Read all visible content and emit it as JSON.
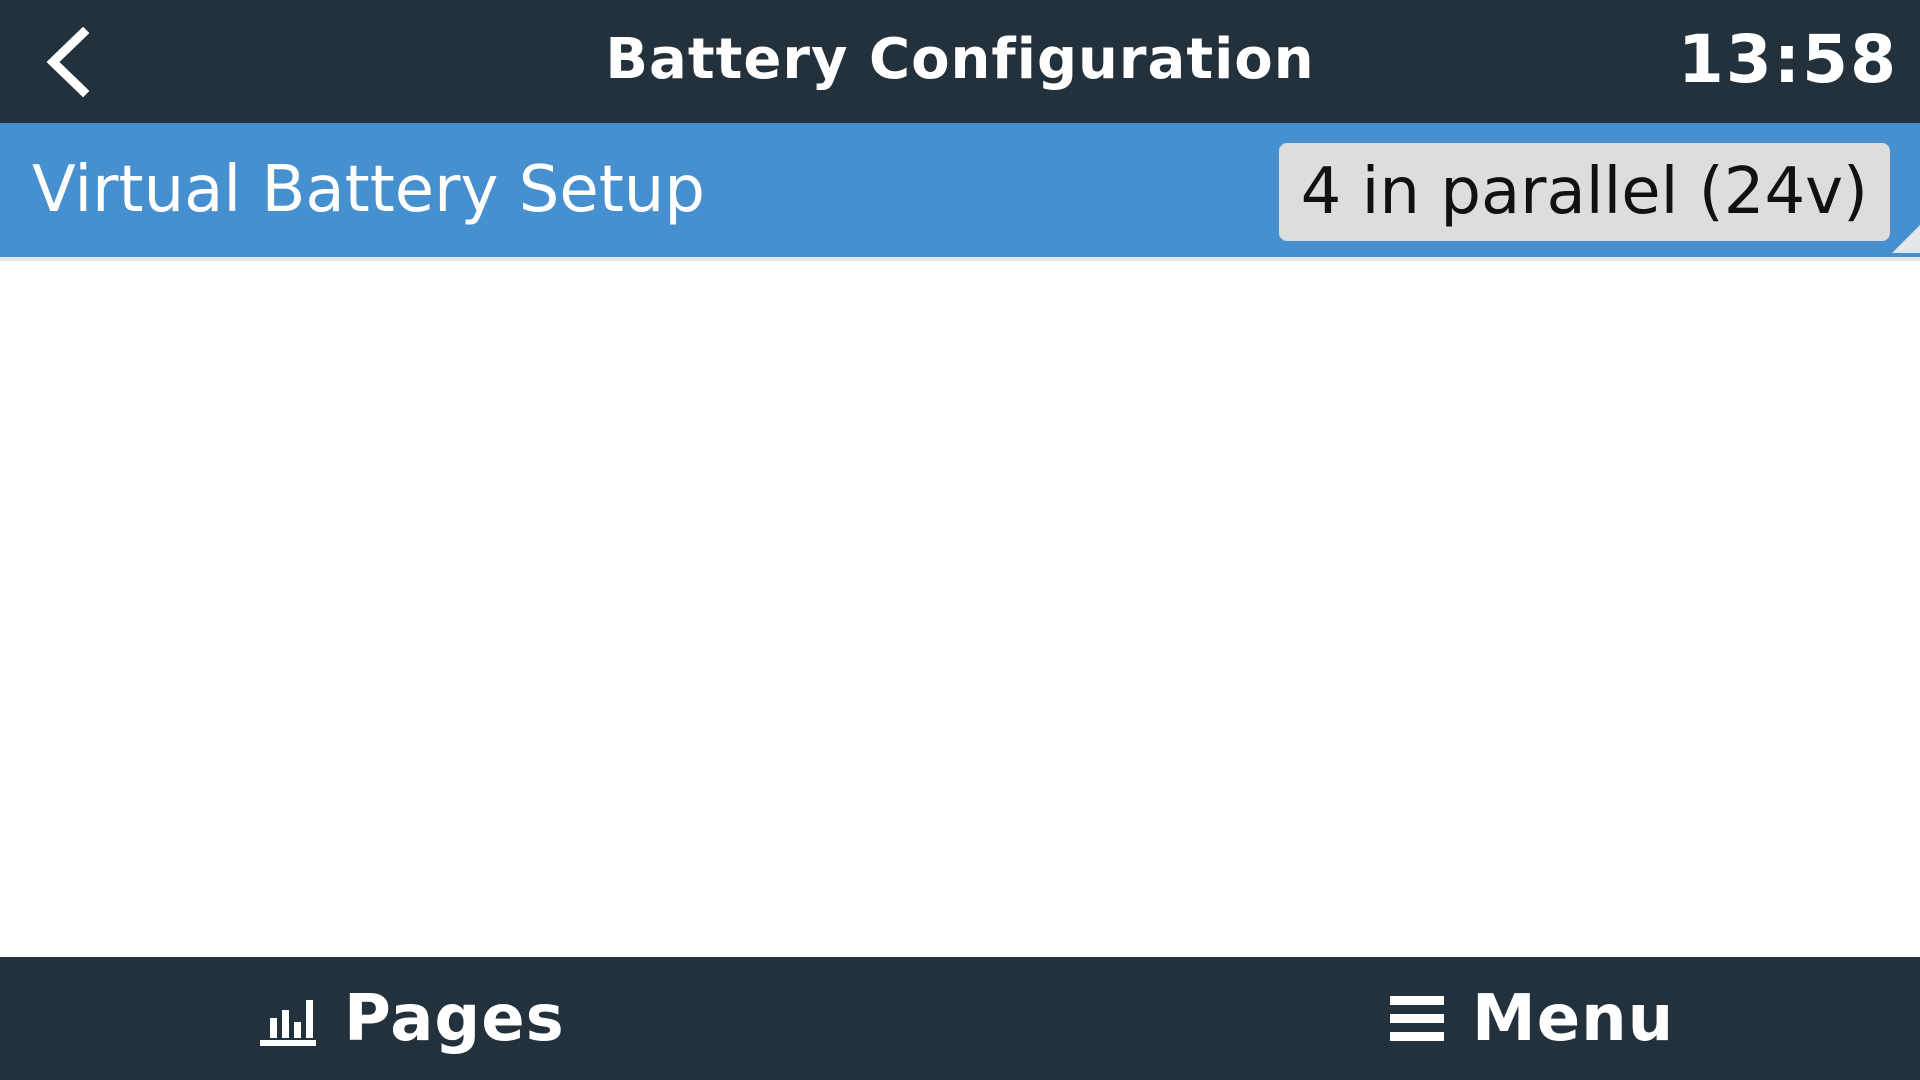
{
  "header": {
    "back_icon": "chevron-left-icon",
    "title": "Battery Configuration",
    "clock": "13:58"
  },
  "list": {
    "items": [
      {
        "label": "Virtual Battery Setup",
        "value": "4 in parallel (24v)"
      }
    ]
  },
  "footer": {
    "pages": {
      "icon": "bar-chart-icon",
      "label": "Pages"
    },
    "menu": {
      "icon": "hamburger-menu-icon",
      "label": "Menu"
    }
  },
  "colors": {
    "header_bg": "#22313c",
    "selected_row": "#4790cf",
    "value_bg": "#dcdddd",
    "text_light": "#ffffff"
  }
}
